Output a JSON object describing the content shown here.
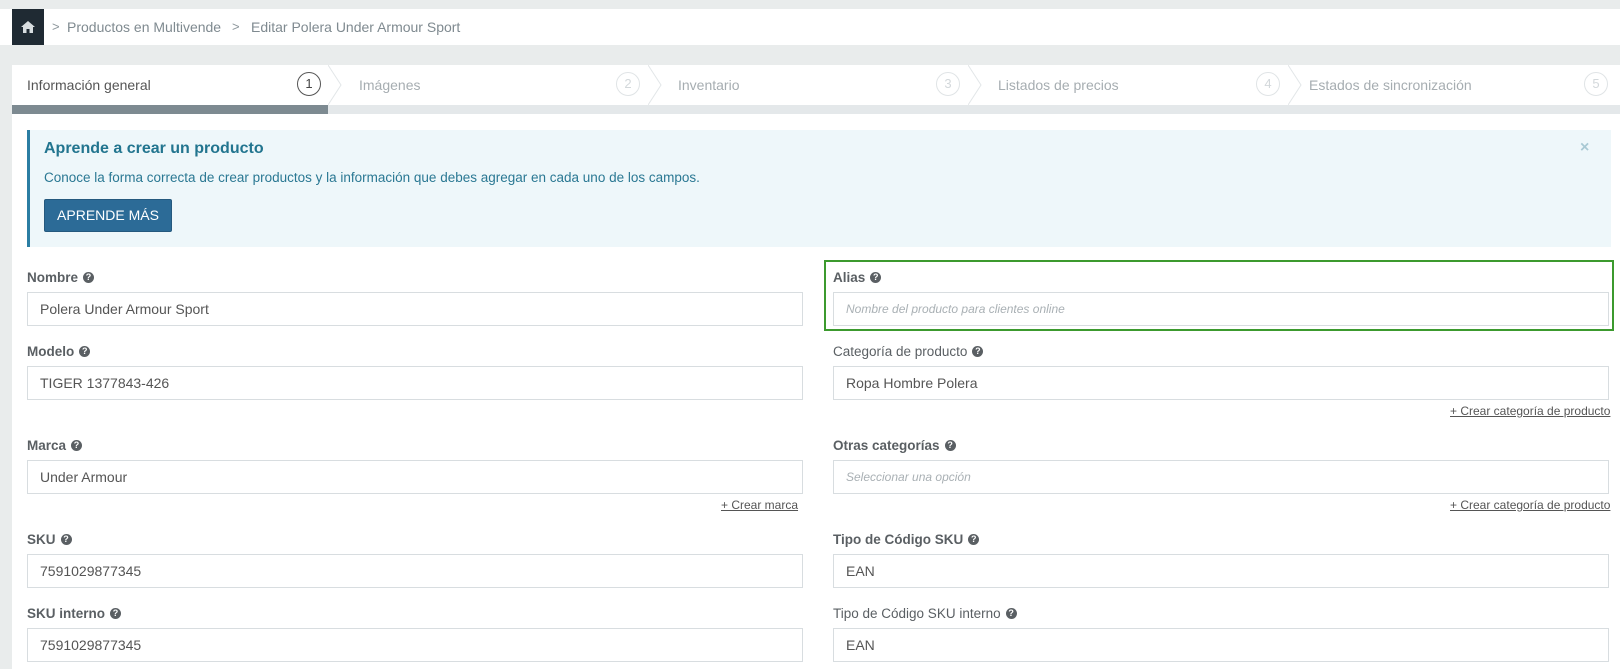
{
  "breadcrumb": {
    "items": [
      "Productos en Multivende",
      "Editar Polera Under Armour Sport"
    ],
    "separator": ">"
  },
  "steps": [
    {
      "label": "Información general",
      "num": "1",
      "active": true
    },
    {
      "label": "Imágenes",
      "num": "2",
      "active": false
    },
    {
      "label": "Inventario",
      "num": "3",
      "active": false
    },
    {
      "label": "Listados de precios",
      "num": "4",
      "active": false
    },
    {
      "label": "Estados de sincronización",
      "num": "5",
      "active": false
    }
  ],
  "callout": {
    "title": "Aprende a crear un producto",
    "text": "Conoce la forma correcta de crear productos y la información que debes agregar en cada uno de los campos.",
    "button": "APRENDE MÁS",
    "close": "×"
  },
  "form": {
    "nombre": {
      "label": "Nombre",
      "value": "Polera Under Armour Sport"
    },
    "alias": {
      "label": "Alias",
      "placeholder": "Nombre del producto para clientes online"
    },
    "modelo": {
      "label": "Modelo",
      "value": "TIGER 1377843-426"
    },
    "categoria": {
      "label": "Categoría de producto",
      "value": "Ropa Hombre Polera",
      "link": "+ Crear categoría de producto"
    },
    "marca": {
      "label": "Marca",
      "value": "Under Armour",
      "link": "+ Crear marca"
    },
    "otras": {
      "label": "Otras categorías",
      "placeholder": "Seleccionar una opción",
      "link": "+ Crear categoría de producto"
    },
    "sku": {
      "label": "SKU",
      "value": "7591029877345"
    },
    "tipo_sku": {
      "label": "Tipo de Código SKU",
      "value": "EAN"
    },
    "sku_interno": {
      "label": "SKU interno",
      "value": "7591029877345"
    },
    "tipo_sku_interno": {
      "label": "Tipo de Código SKU interno",
      "value": "EAN"
    }
  },
  "colors": {
    "highlight": "#3c9a2e",
    "primary": "#2c6b97",
    "callout_bg": "#eef7fa"
  },
  "icons": {
    "home": "home-icon",
    "help": "question-circle-icon"
  }
}
